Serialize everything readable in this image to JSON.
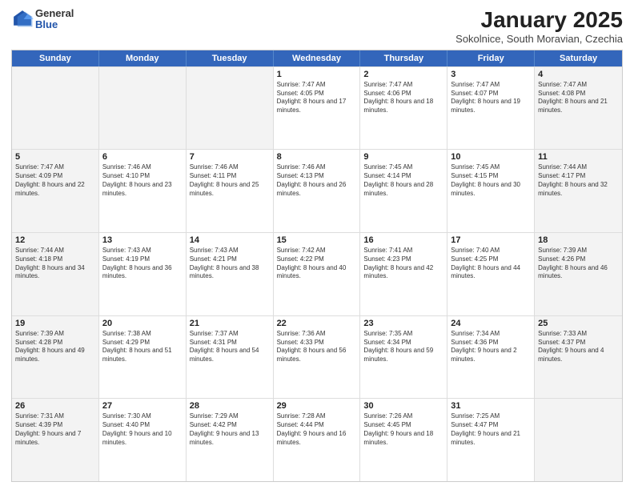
{
  "logo": {
    "general": "General",
    "blue": "Blue"
  },
  "header": {
    "title": "January 2025",
    "subtitle": "Sokolnice, South Moravian, Czechia"
  },
  "weekdays": [
    "Sunday",
    "Monday",
    "Tuesday",
    "Wednesday",
    "Thursday",
    "Friday",
    "Saturday"
  ],
  "rows": [
    [
      {
        "day": "",
        "sunrise": "",
        "sunset": "",
        "daylight": "",
        "shaded": true
      },
      {
        "day": "",
        "sunrise": "",
        "sunset": "",
        "daylight": "",
        "shaded": true
      },
      {
        "day": "",
        "sunrise": "",
        "sunset": "",
        "daylight": "",
        "shaded": true
      },
      {
        "day": "1",
        "sunrise": "Sunrise: 7:47 AM",
        "sunset": "Sunset: 4:05 PM",
        "daylight": "Daylight: 8 hours and 17 minutes.",
        "shaded": false
      },
      {
        "day": "2",
        "sunrise": "Sunrise: 7:47 AM",
        "sunset": "Sunset: 4:06 PM",
        "daylight": "Daylight: 8 hours and 18 minutes.",
        "shaded": false
      },
      {
        "day": "3",
        "sunrise": "Sunrise: 7:47 AM",
        "sunset": "Sunset: 4:07 PM",
        "daylight": "Daylight: 8 hours and 19 minutes.",
        "shaded": false
      },
      {
        "day": "4",
        "sunrise": "Sunrise: 7:47 AM",
        "sunset": "Sunset: 4:08 PM",
        "daylight": "Daylight: 8 hours and 21 minutes.",
        "shaded": true
      }
    ],
    [
      {
        "day": "5",
        "sunrise": "Sunrise: 7:47 AM",
        "sunset": "Sunset: 4:09 PM",
        "daylight": "Daylight: 8 hours and 22 minutes.",
        "shaded": true
      },
      {
        "day": "6",
        "sunrise": "Sunrise: 7:46 AM",
        "sunset": "Sunset: 4:10 PM",
        "daylight": "Daylight: 8 hours and 23 minutes.",
        "shaded": false
      },
      {
        "day": "7",
        "sunrise": "Sunrise: 7:46 AM",
        "sunset": "Sunset: 4:11 PM",
        "daylight": "Daylight: 8 hours and 25 minutes.",
        "shaded": false
      },
      {
        "day": "8",
        "sunrise": "Sunrise: 7:46 AM",
        "sunset": "Sunset: 4:13 PM",
        "daylight": "Daylight: 8 hours and 26 minutes.",
        "shaded": false
      },
      {
        "day": "9",
        "sunrise": "Sunrise: 7:45 AM",
        "sunset": "Sunset: 4:14 PM",
        "daylight": "Daylight: 8 hours and 28 minutes.",
        "shaded": false
      },
      {
        "day": "10",
        "sunrise": "Sunrise: 7:45 AM",
        "sunset": "Sunset: 4:15 PM",
        "daylight": "Daylight: 8 hours and 30 minutes.",
        "shaded": false
      },
      {
        "day": "11",
        "sunrise": "Sunrise: 7:44 AM",
        "sunset": "Sunset: 4:17 PM",
        "daylight": "Daylight: 8 hours and 32 minutes.",
        "shaded": true
      }
    ],
    [
      {
        "day": "12",
        "sunrise": "Sunrise: 7:44 AM",
        "sunset": "Sunset: 4:18 PM",
        "daylight": "Daylight: 8 hours and 34 minutes.",
        "shaded": true
      },
      {
        "day": "13",
        "sunrise": "Sunrise: 7:43 AM",
        "sunset": "Sunset: 4:19 PM",
        "daylight": "Daylight: 8 hours and 36 minutes.",
        "shaded": false
      },
      {
        "day": "14",
        "sunrise": "Sunrise: 7:43 AM",
        "sunset": "Sunset: 4:21 PM",
        "daylight": "Daylight: 8 hours and 38 minutes.",
        "shaded": false
      },
      {
        "day": "15",
        "sunrise": "Sunrise: 7:42 AM",
        "sunset": "Sunset: 4:22 PM",
        "daylight": "Daylight: 8 hours and 40 minutes.",
        "shaded": false
      },
      {
        "day": "16",
        "sunrise": "Sunrise: 7:41 AM",
        "sunset": "Sunset: 4:23 PM",
        "daylight": "Daylight: 8 hours and 42 minutes.",
        "shaded": false
      },
      {
        "day": "17",
        "sunrise": "Sunrise: 7:40 AM",
        "sunset": "Sunset: 4:25 PM",
        "daylight": "Daylight: 8 hours and 44 minutes.",
        "shaded": false
      },
      {
        "day": "18",
        "sunrise": "Sunrise: 7:39 AM",
        "sunset": "Sunset: 4:26 PM",
        "daylight": "Daylight: 8 hours and 46 minutes.",
        "shaded": true
      }
    ],
    [
      {
        "day": "19",
        "sunrise": "Sunrise: 7:39 AM",
        "sunset": "Sunset: 4:28 PM",
        "daylight": "Daylight: 8 hours and 49 minutes.",
        "shaded": true
      },
      {
        "day": "20",
        "sunrise": "Sunrise: 7:38 AM",
        "sunset": "Sunset: 4:29 PM",
        "daylight": "Daylight: 8 hours and 51 minutes.",
        "shaded": false
      },
      {
        "day": "21",
        "sunrise": "Sunrise: 7:37 AM",
        "sunset": "Sunset: 4:31 PM",
        "daylight": "Daylight: 8 hours and 54 minutes.",
        "shaded": false
      },
      {
        "day": "22",
        "sunrise": "Sunrise: 7:36 AM",
        "sunset": "Sunset: 4:33 PM",
        "daylight": "Daylight: 8 hours and 56 minutes.",
        "shaded": false
      },
      {
        "day": "23",
        "sunrise": "Sunrise: 7:35 AM",
        "sunset": "Sunset: 4:34 PM",
        "daylight": "Daylight: 8 hours and 59 minutes.",
        "shaded": false
      },
      {
        "day": "24",
        "sunrise": "Sunrise: 7:34 AM",
        "sunset": "Sunset: 4:36 PM",
        "daylight": "Daylight: 9 hours and 2 minutes.",
        "shaded": false
      },
      {
        "day": "25",
        "sunrise": "Sunrise: 7:33 AM",
        "sunset": "Sunset: 4:37 PM",
        "daylight": "Daylight: 9 hours and 4 minutes.",
        "shaded": true
      }
    ],
    [
      {
        "day": "26",
        "sunrise": "Sunrise: 7:31 AM",
        "sunset": "Sunset: 4:39 PM",
        "daylight": "Daylight: 9 hours and 7 minutes.",
        "shaded": true
      },
      {
        "day": "27",
        "sunrise": "Sunrise: 7:30 AM",
        "sunset": "Sunset: 4:40 PM",
        "daylight": "Daylight: 9 hours and 10 minutes.",
        "shaded": false
      },
      {
        "day": "28",
        "sunrise": "Sunrise: 7:29 AM",
        "sunset": "Sunset: 4:42 PM",
        "daylight": "Daylight: 9 hours and 13 minutes.",
        "shaded": false
      },
      {
        "day": "29",
        "sunrise": "Sunrise: 7:28 AM",
        "sunset": "Sunset: 4:44 PM",
        "daylight": "Daylight: 9 hours and 16 minutes.",
        "shaded": false
      },
      {
        "day": "30",
        "sunrise": "Sunrise: 7:26 AM",
        "sunset": "Sunset: 4:45 PM",
        "daylight": "Daylight: 9 hours and 18 minutes.",
        "shaded": false
      },
      {
        "day": "31",
        "sunrise": "Sunrise: 7:25 AM",
        "sunset": "Sunset: 4:47 PM",
        "daylight": "Daylight: 9 hours and 21 minutes.",
        "shaded": false
      },
      {
        "day": "",
        "sunrise": "",
        "sunset": "",
        "daylight": "",
        "shaded": true
      }
    ]
  ]
}
